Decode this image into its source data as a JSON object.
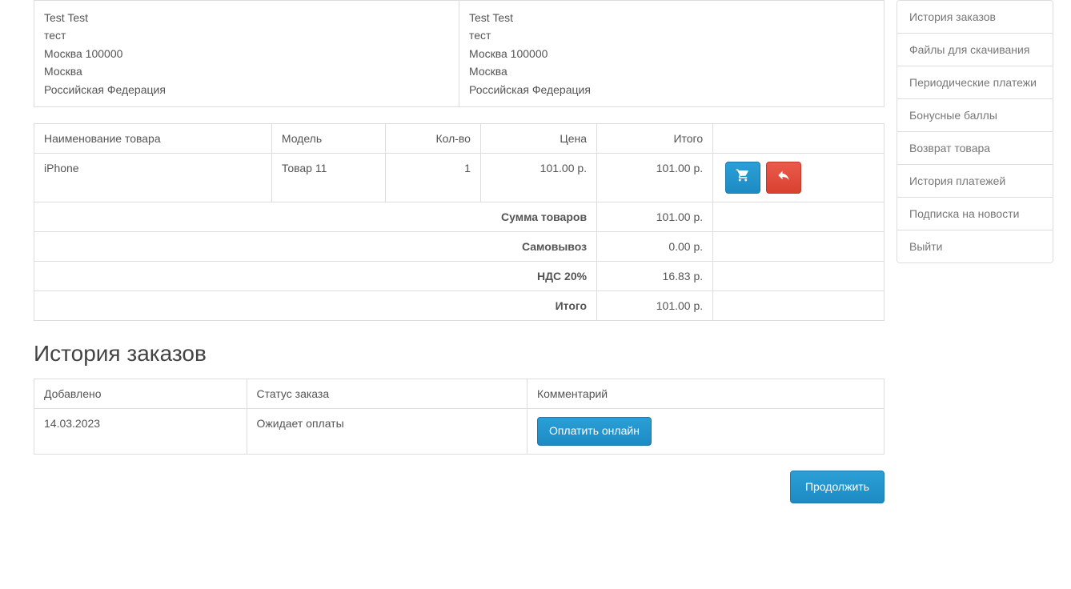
{
  "addresses": {
    "left": {
      "name": "Test Test",
      "line1": "тест",
      "line2": "Москва 100000",
      "city": "Москва",
      "country": "Российская Федерация"
    },
    "right": {
      "name": "Test Test",
      "line1": "тест",
      "line2": "Москва 100000",
      "city": "Москва",
      "country": "Российская Федерация"
    }
  },
  "products": {
    "headers": {
      "name": "Наименование товара",
      "model": "Модель",
      "qty": "Кол-во",
      "price": "Цена",
      "total": "Итого"
    },
    "rows": [
      {
        "name": "iPhone",
        "model": "Товар 11",
        "qty": "1",
        "price": "101.00 р.",
        "total": "101.00 р."
      }
    ],
    "totals": [
      {
        "label": "Сумма товаров",
        "value": "101.00 р."
      },
      {
        "label": "Самовывоз",
        "value": "0.00 р."
      },
      {
        "label": "НДС 20%",
        "value": "16.83 р."
      },
      {
        "label": "Итого",
        "value": "101.00 р."
      }
    ]
  },
  "history": {
    "heading": "История заказов",
    "headers": {
      "added": "Добавлено",
      "status": "Статус заказа",
      "comment": "Комментарий"
    },
    "rows": [
      {
        "added": "14.03.2023",
        "status": "Ожидает оплаты",
        "pay_button": "Оплатить онлайн"
      }
    ]
  },
  "continue_button": "Продолжить",
  "sidebar": {
    "items": [
      "История заказов",
      "Файлы для скачивания",
      "Периодические платежи",
      "Бонусные баллы",
      "Возврат товара",
      "История платежей",
      "Подписка на новости",
      "Выйти"
    ]
  }
}
